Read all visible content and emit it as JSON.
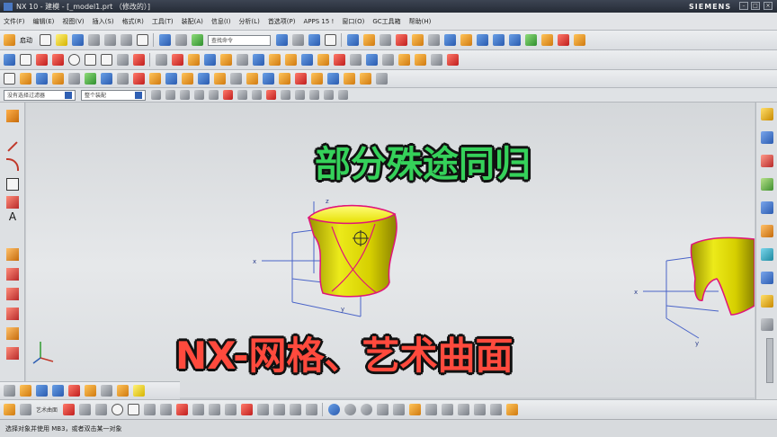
{
  "window": {
    "title": "NX 10 - 建模 - [_model1.prt （修改的）]",
    "brand": "SIEMENS",
    "minimize_glyph": "–",
    "maximize_glyph": "□",
    "close_glyph": "×"
  },
  "menu": {
    "items": [
      "文件(F)",
      "编辑(E)",
      "视图(V)",
      "插入(S)",
      "格式(R)",
      "工具(T)",
      "装配(A)",
      "信息(I)",
      "分析(L)",
      "首选项(P)",
      "APPS 15 !",
      "窗口(O)",
      "GC工具箱",
      "帮助(H)"
    ]
  },
  "toolbar": {
    "start_label": "启动",
    "search_placeholder": "查找命令",
    "selection_filter": "没有选择过滤器",
    "assembly_scope": "整个装配"
  },
  "left_toolbar": {
    "text_tool_glyph": "A"
  },
  "overlay": {
    "headline": "部分殊途同归",
    "subtitle": "NX-网格、艺术曲面"
  },
  "axes": {
    "x_label": "x",
    "y_label": "y",
    "z_label": "z"
  },
  "bottom_toolbar": {
    "surface_label": "艺术曲面"
  },
  "status": {
    "prompt": "选择对象并使用 MB3，或者双击某一对象"
  },
  "colors": {
    "accent": "#2a5bb0",
    "surface_yellow": "#e6e000",
    "edge_magenta": "#e0147a",
    "headline_green": "#35d15a",
    "subtitle_red": "#ff4a3d"
  }
}
